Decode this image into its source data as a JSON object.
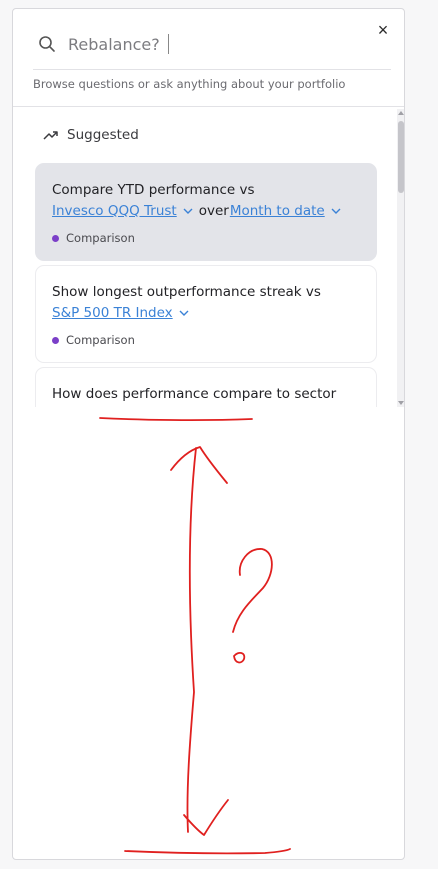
{
  "search": {
    "placeholder": "Rebalance?"
  },
  "close_label": "×",
  "helper_text": "Browse questions or ask anything about your portfolio",
  "section": {
    "title": "Suggested"
  },
  "cards": [
    {
      "title": "Compare YTD performance vs",
      "dropdown_1": "Invesco QQQ Trust",
      "joiner": "over",
      "dropdown_2": "Month to date",
      "tag": "Comparison"
    },
    {
      "title": "Show longest outperformance streak vs",
      "dropdown_1": "S&P 500 TR Index",
      "tag": "Comparison"
    },
    {
      "title": "How does performance compare to sector"
    }
  ],
  "colors": {
    "accent_link": "#3b82d6",
    "tag_dot": "#7b3fc8",
    "active_card": "#e3e4e9",
    "annotation": "#e0201f"
  },
  "icons": [
    "search-icon",
    "close-icon",
    "trend-up-icon",
    "chevron-down-icon"
  ]
}
